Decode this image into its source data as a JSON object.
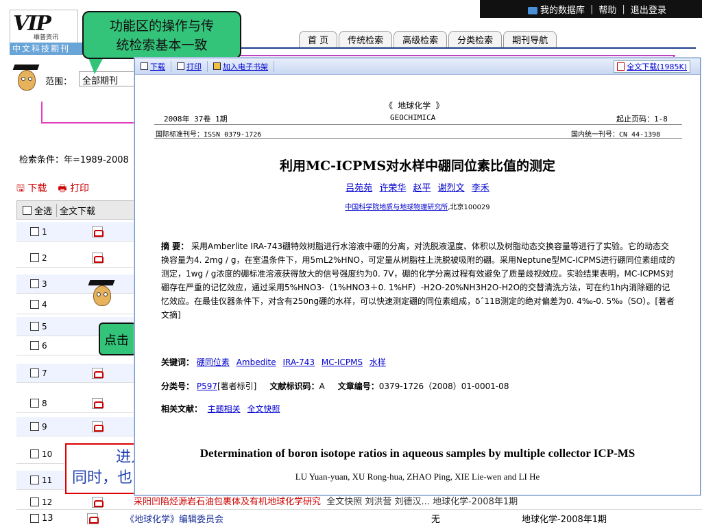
{
  "topbar": {
    "my_db": "我的数据库",
    "help": "帮助",
    "logout": "退出登录",
    "sep": "|"
  },
  "logo": {
    "mark": "VIP",
    "sub": "维普资讯",
    "bar": "中文科技期刊"
  },
  "nav": {
    "tabs": [
      "首  页",
      "传统检索",
      "高级检索",
      "分类检索",
      "期刊导航"
    ]
  },
  "callouts": {
    "green1": [
      "功能区的操作与传",
      "统检索基本一致"
    ],
    "green2": "点击",
    "red": [
      "进入",
      "同时，也"
    ]
  },
  "background": {
    "scope_label": "范围：",
    "scope_value": "全部期刊",
    "condition": "检索条件：年=1989-2008",
    "download": "下载",
    "print": "打印",
    "select_all": "全选",
    "fulltext_col": "全文下载",
    "rows": [
      "1",
      "2",
      "3",
      "4",
      "5",
      "6",
      "7",
      "8",
      "9",
      "10",
      "11",
      "12",
      "13"
    ],
    "row12_title": "采阳凹陷烃源岩石油包裹体及有机地球化学研究",
    "row12_extra": "全文快照  刘洪营  刘德汉...  地球化学-2008年1期",
    "row13_title": "《地球化学》编辑委员会",
    "row13_author": "无",
    "row13_source": "地球化学-2008年1期"
  },
  "popup": {
    "toolbar": {
      "download": "下载",
      "print": "打印",
      "bookshelf": "加入电子书架",
      "fulltext": "全文下载(1985K)"
    },
    "journal_cn": "《 地球化学 》",
    "journal_en": "GEOCHIMICA",
    "issue": "2008年 37卷 1期",
    "pages": "起止页码：1-8",
    "issn": "国际标准刊号：ISSN 0379-1726",
    "cn": "国内统一刊号：CN 44-1398",
    "title": "利用MC-ICPMS对水样中硼同位素比值的测定",
    "authors": [
      "吕苑苑",
      "许荣华",
      "赵平",
      "谢烈文",
      "李禾"
    ],
    "affiliation_link": "中国科学院地质与地球物理研究所",
    "affiliation_rest": ",北京100029",
    "abstract_label": "摘  要：",
    "abstract": "采用Amberlite IRA-743硼特效树脂进行水溶液中硼的分离，对洗脱液温度、体积以及树脂动态交换容量等进行了实验。它的动态交换容量为4. 2mg / g，在室温条件下，用5mL2%HNO，可定量从树脂柱上洗脱被吸附的硼。采用Neptune型MC-ICPMS进行硼同位素组成的测定，1wg / g浓度的硼标准溶液获得放大的信号强度约为0. 7V，硼的化学分离过程有效避免了质量歧视效应。实验结果表明，MC-ICPMS对硼存在严重的记忆效应，通过采用5%HNO3-（1%HNO3＋0. 1%HF）-H2O-20%NH3H2O-H2O的交替清洗方法，可在约1h内消除硼的记忆效应。在最佳仪器条件下，对含有250ng硼的水样，可以快速测定硼的同位素组成，δˆ11B测定的绝对偏差为0. 4‰-0. 5‰（SO）。[著者文摘]",
    "keywords_label": "关键词：",
    "keywords": [
      "硼同位素",
      "Ambedite",
      "IRA-743",
      "MC-ICPMS",
      "水样"
    ],
    "class_label": "分类号：",
    "class_code": "P597",
    "class_note": "[著者标引]",
    "doccode_label": "文献标识码：",
    "doccode": "A",
    "artno_label": "文章编号：",
    "artno": "0379-1726（2008）01-0001-08",
    "related_label": "相关文献：",
    "related": [
      "主题相关",
      "全文快照"
    ],
    "en_title": "Determination of boron isotope ratios in aqueous samples by multiple collector ICP-MS",
    "en_authors": "LU Yuan-yuan, XU Rong-hua, ZHAO Ping, XIE Lie-wen and LI He"
  }
}
